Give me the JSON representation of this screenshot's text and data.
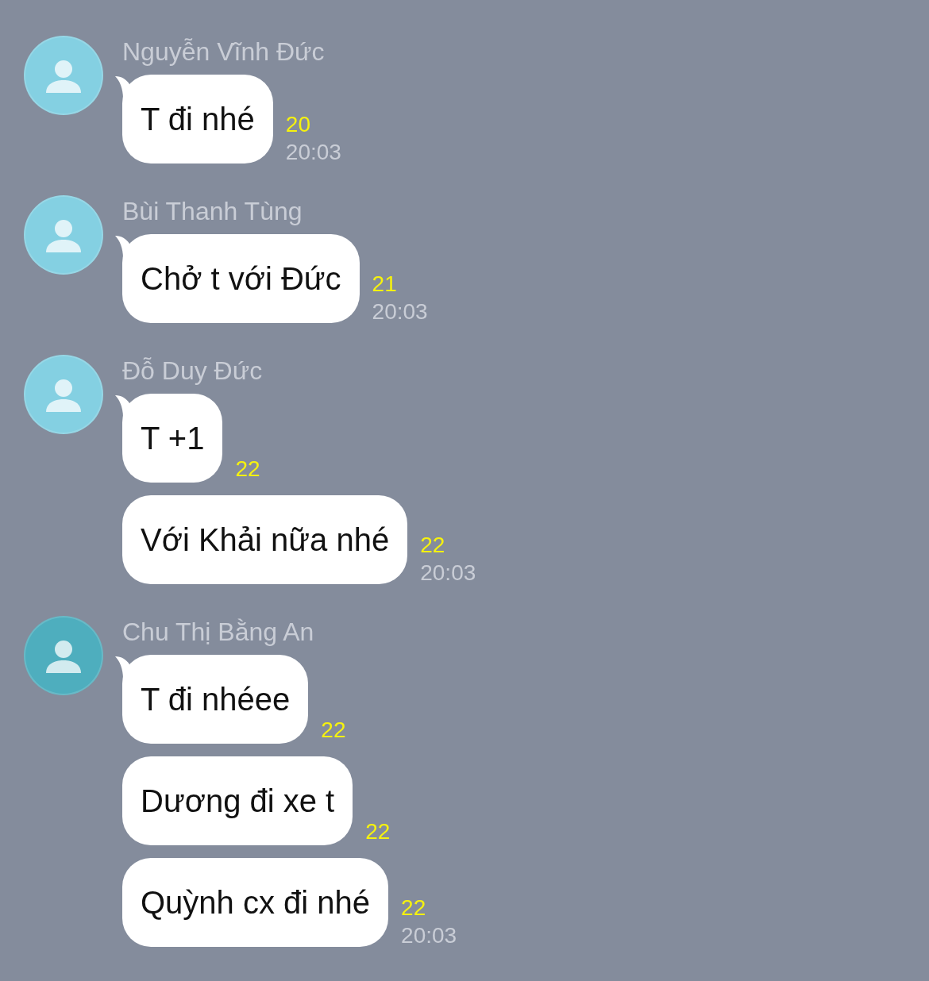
{
  "groups": [
    {
      "sender": "Nguyễn Vĩnh Đức",
      "color": "#84d0e2",
      "messages": [
        {
          "text": "T đi nhé",
          "read_count": "20",
          "time": "20:03"
        }
      ]
    },
    {
      "sender": "Bùi Thanh Tùng",
      "color": "#84d0e2",
      "messages": [
        {
          "text": "Chở t với Đức",
          "read_count": "21",
          "time": "20:03"
        }
      ]
    },
    {
      "sender": "Đỗ Duy Đức",
      "color": "#84d0e2",
      "messages": [
        {
          "text": "T +1",
          "read_count": "22"
        },
        {
          "text": "Với Khải nữa nhé",
          "read_count": "22",
          "time": "20:03"
        }
      ]
    },
    {
      "sender": "Chu Thị Bằng An",
      "color": "#4eaebe",
      "messages": [
        {
          "text": "T đi nhéee",
          "read_count": "22"
        },
        {
          "text": "Dương đi xe t",
          "read_count": "22"
        },
        {
          "text": "Quỳnh cx đi nhé",
          "read_count": "22",
          "time": "20:03"
        }
      ]
    }
  ]
}
